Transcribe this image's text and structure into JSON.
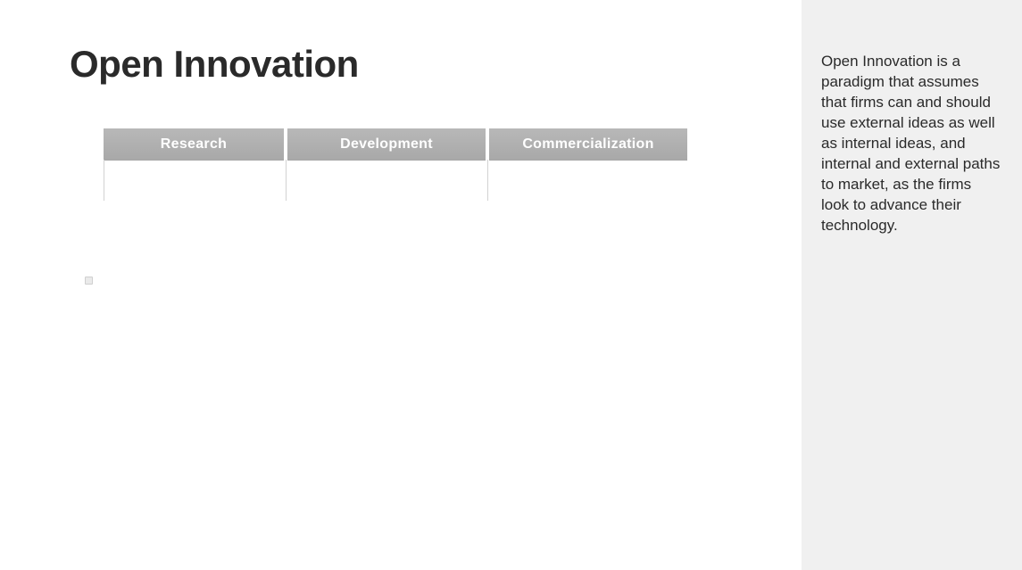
{
  "main": {
    "title": "Open Innovation",
    "tabs": [
      {
        "label": "Research"
      },
      {
        "label": "Development"
      },
      {
        "label": "Commercialization"
      }
    ]
  },
  "sidebar": {
    "paragraph": "Open Innovation is a paradigm that assumes that firms can and should use external ideas as well as internal ideas, and internal and external paths to market, as the firms look to advance their technology."
  }
}
